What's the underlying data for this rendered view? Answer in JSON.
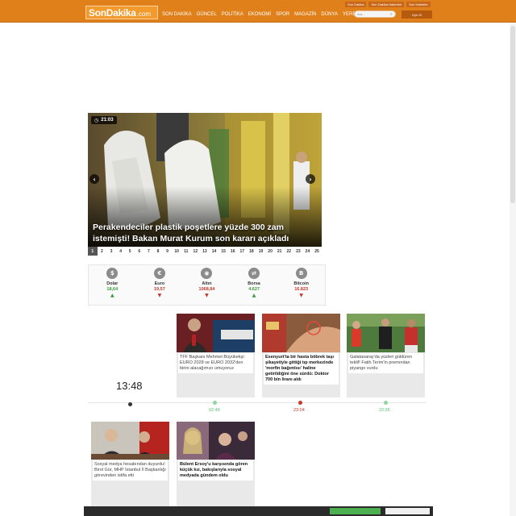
{
  "header": {
    "logo_brand": "SonDakika",
    "logo_tld": ".com",
    "nav": [
      "SON DAKİKA",
      "GÜNCEL",
      "POLİTİKA",
      "EKONOMİ",
      "SPOR",
      "MAGAZİN",
      "DÜNYA",
      "YEREL"
    ],
    "quick_links": [
      "Son Dakika",
      "Son Dakika Haberleri",
      "Son Haberler"
    ],
    "search_placeholder": "Ara...",
    "member_button": "Üye Ol"
  },
  "slider": {
    "time": "21:03",
    "headline": "Perakendeciler plastik poşetlere yüzde 300 zam istemişti! Bakan Murat Kurum son kararı açıkladı",
    "pages": [
      "1",
      "2",
      "3",
      "4",
      "5",
      "6",
      "7",
      "8",
      "9",
      "10",
      "11",
      "12",
      "13",
      "14",
      "15",
      "16",
      "17",
      "18",
      "19",
      "20",
      "21",
      "22",
      "23",
      "24",
      "25"
    ],
    "active_page": "1"
  },
  "markets": [
    {
      "name": "Dolar",
      "value": "18,64",
      "trend": "up",
      "icon": "$",
      "arrow": "▲"
    },
    {
      "name": "Euro",
      "value": "19,57",
      "trend": "down",
      "icon": "€",
      "arrow": "▼"
    },
    {
      "name": "Altın",
      "value": "1068,84",
      "trend": "down",
      "icon": "◉",
      "arrow": "▼"
    },
    {
      "name": "Borsa",
      "value": "4.627",
      "trend": "up",
      "icon": "⇄",
      "arrow": "▲"
    },
    {
      "name": "Bitcoin",
      "value": "16.823",
      "trend": "down",
      "icon": "B",
      "arrow": "▼"
    }
  ],
  "clock": "13:48",
  "colors": {
    "header_orange": "#e0801b",
    "up": "#3a9a3a",
    "down": "#c0392b"
  },
  "cards": [
    {
      "caption": "TFF Başkanı Mehmet Büyükekşi: EURO 2028 ve EURO 2032'den birini alacağımızı umuyoruz",
      "time": "02:48",
      "time_color": "#5dbb73"
    },
    {
      "caption": "Esenyurt'ta bir hasta böbrek taşı şikayetiyle gittiği tıp merkezinde 'morfin bağımlısı' haline getirildiğini öne sürdü: Doktor 700 bin liranı aldı",
      "time": "23:04",
      "time_color": "#c0392b"
    },
    {
      "caption": "Galatasaray'da yüzleri güldüren teklif! Fatih Terim'in premından piyango vurdu",
      "time": "22:36",
      "time_color": "#5dbb73"
    },
    {
      "caption": "Sosyal medya hesabından duyurdu! Birol Gür, MHP İstanbul İl Başkanlığı görevinden istifa etti"
    },
    {
      "caption": "Bülent Ersoy'u karşısında gören küçük kız, bakışlarıyla sosyal medyada gündem oldu"
    }
  ]
}
